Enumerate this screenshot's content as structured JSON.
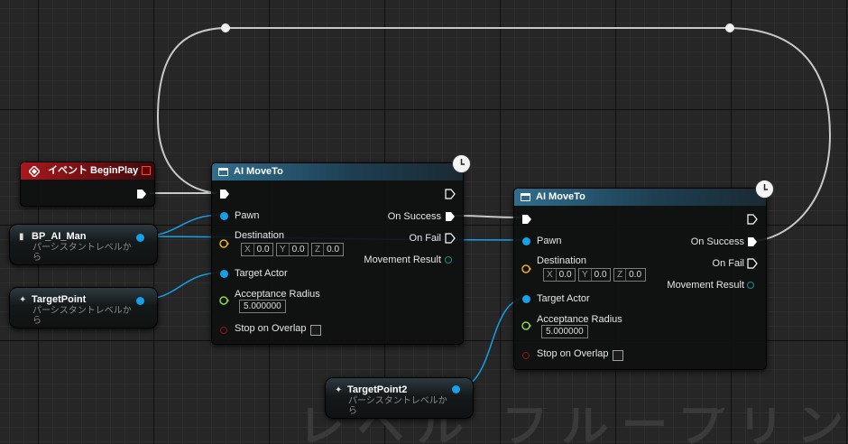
{
  "watermark": "レベル ブループリント",
  "event_node": {
    "title": "イベント BeginPlay"
  },
  "move1": {
    "title": "AI MoveTo",
    "inputs": {
      "pawn": "Pawn",
      "destination": "Destination",
      "target_actor": "Target Actor",
      "acceptance_radius": "Acceptance Radius",
      "stop_on_overlap": "Stop on Overlap"
    },
    "outputs": {
      "on_success": "On Success",
      "on_fail": "On Fail",
      "movement_result": "Movement Result"
    },
    "destination_value": {
      "x_label": "X",
      "x": "0.0",
      "y_label": "Y",
      "y": "0.0",
      "z_label": "Z",
      "z": "0.0"
    },
    "radius_value": "5.000000"
  },
  "move2": {
    "title": "AI MoveTo",
    "inputs": {
      "pawn": "Pawn",
      "destination": "Destination",
      "target_actor": "Target Actor",
      "acceptance_radius": "Acceptance Radius",
      "stop_on_overlap": "Stop on Overlap"
    },
    "outputs": {
      "on_success": "On Success",
      "on_fail": "On Fail",
      "movement_result": "Movement Result"
    },
    "destination_value": {
      "x_label": "X",
      "x": "0.0",
      "y_label": "Y",
      "y": "0.0",
      "z_label": "Z",
      "z": "0.0"
    },
    "radius_value": "5.000000"
  },
  "variables": [
    {
      "title": "BP_AI_Man",
      "subtitle": "パーシスタントレベルから"
    },
    {
      "title": "TargetPoint",
      "subtitle": "パーシスタントレベルから"
    },
    {
      "title": "TargetPoint2",
      "subtitle": "パーシスタントレベルから"
    }
  ],
  "colors": {
    "exec_wire": "#d8d8d8",
    "object_pin": "#15a0e8",
    "vector_pin": "#e8b21c",
    "float_pin": "#8fd44a",
    "bool_pin": "#8c1414",
    "enum_pin": "#1f8c86"
  }
}
